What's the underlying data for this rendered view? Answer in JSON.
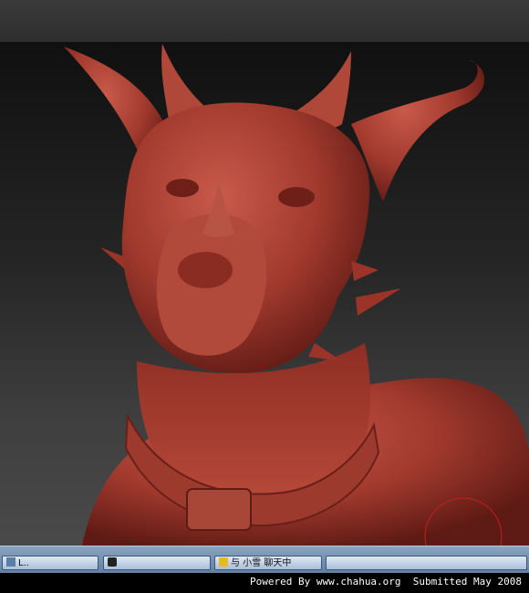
{
  "render": {
    "subject_color": "#a23a2e",
    "background_top": "#101010",
    "background_bottom": "#4a4a4a"
  },
  "taskbar": {
    "tasks": [
      {
        "label": "L..",
        "icon": "window-icon"
      },
      {
        "label": "",
        "icon": "app-icon"
      },
      {
        "label": "与 小雪 聊天中",
        "icon": "chat-icon"
      },
      {
        "label": "",
        "icon": "window-icon"
      }
    ]
  },
  "footer": {
    "credit": "Powered By www.chahua.org  Submitted May 2008"
  }
}
